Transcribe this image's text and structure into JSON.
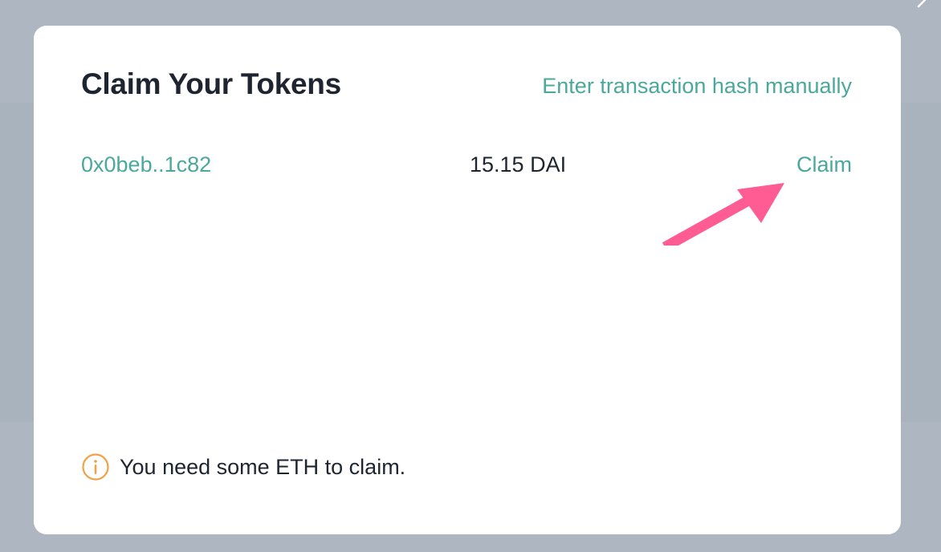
{
  "modal": {
    "title": "Claim Your Tokens",
    "manual_link": "Enter transaction hash manually"
  },
  "claims": [
    {
      "tx_hash": "0x0beb..1c82",
      "amount": "15.15 DAI",
      "action_label": "Claim"
    }
  ],
  "notice": {
    "icon": "info-icon",
    "text": "You need some ETH to claim."
  },
  "colors": {
    "backdrop": "#aeb7c1",
    "accent": "#4aa89c",
    "text": "#1f2530",
    "warning": "#f0a24a",
    "annotation_arrow": "#ff5c93"
  }
}
